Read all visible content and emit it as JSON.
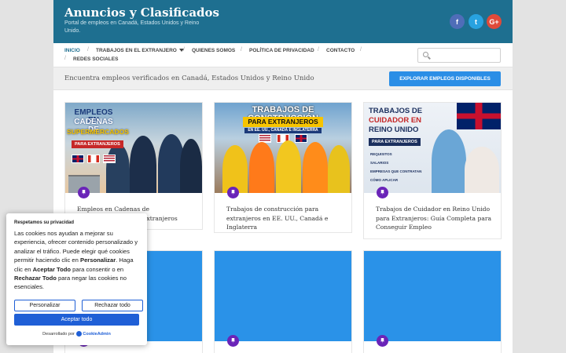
{
  "site": {
    "title": "Anuncios y Clasificados",
    "tagline": "Portal de empleos en Canadá, Estados Unidos y Reino Unido."
  },
  "social": {
    "facebook": "f",
    "twitter": "t",
    "googleplus": "G+"
  },
  "nav": {
    "items": [
      "INICIO",
      "TRABAJOS EN EL EXTRANJERO",
      "QUIENES SOMOS",
      "POLÍTICA DE PRIVACIDAD",
      "CONTACTO",
      "REDES SOCIALES"
    ],
    "active": "INICIO"
  },
  "search": {
    "placeholder": ""
  },
  "banner": {
    "text": "Encuentra empleos verificados en Canadá, Estados Unidos y Reino Unido",
    "button": "EXPLORAR EMPLEOS DISPONIBLES"
  },
  "cards": [
    {
      "title": "Empleos en Cadenas de Supermercados para Extranjeros",
      "poster": {
        "line1": "EMPLEOS EN",
        "line2": "CADENAS DE",
        "line3": "SUPERMERCADOS",
        "tag": "PARA EXTRANJEROS"
      }
    },
    {
      "title": "Trabajos de construcción para extranjeros en EE. UU., Canadá e Inglaterra",
      "poster": {
        "line1": "TRABAJOS DE CONSTRUCCIÓN",
        "line2": "PARA EXTRANJEROS",
        "sub": "EN EE. UU., CANADÁ E INGLATERRA"
      }
    },
    {
      "title": "Trabajos de Cuidador en Reino Unido para Extranjeros: Guía Completa para Conseguir Empleo",
      "poster": {
        "line1": "TRABAJOS DE",
        "line2": "CUIDADOR EN",
        "line3": "REINO UNIDO",
        "tag": "PARA EXTRANJEROS",
        "list": [
          "REQUISITOS",
          "SALARIOS",
          "EMPRESAS QUE CONTRATAN",
          "CÓMO APLICAR"
        ]
      }
    },
    {
      "title": ""
    },
    {
      "title": ""
    },
    {
      "title": ""
    }
  ],
  "cookie": {
    "title": "Respetamos su privacidad",
    "body_1": "Las cookies nos ayudan a mejorar su experiencia, ofrecer contenido personalizado y analizar el tráfico. Puede elegir qué cookies permitir haciendo clic en ",
    "body_b1": "Personalizar",
    "body_2": ". Haga clic en ",
    "body_b2": "Aceptar Todo",
    "body_3": " para consentir o en ",
    "body_b3": "Rechazar Todo",
    "body_4": " para negar las cookies no esenciales.",
    "customize": "Personalizar",
    "reject": "Rechazar todo",
    "accept": "Aceptar todo",
    "powered": "Desarrollado por",
    "brand": "CookieAdmin"
  },
  "colors": {
    "header": "#1e6f90",
    "accent": "#2b8ee6",
    "pin": "#6a24b8",
    "cookie_button": "#1f5fd6"
  }
}
